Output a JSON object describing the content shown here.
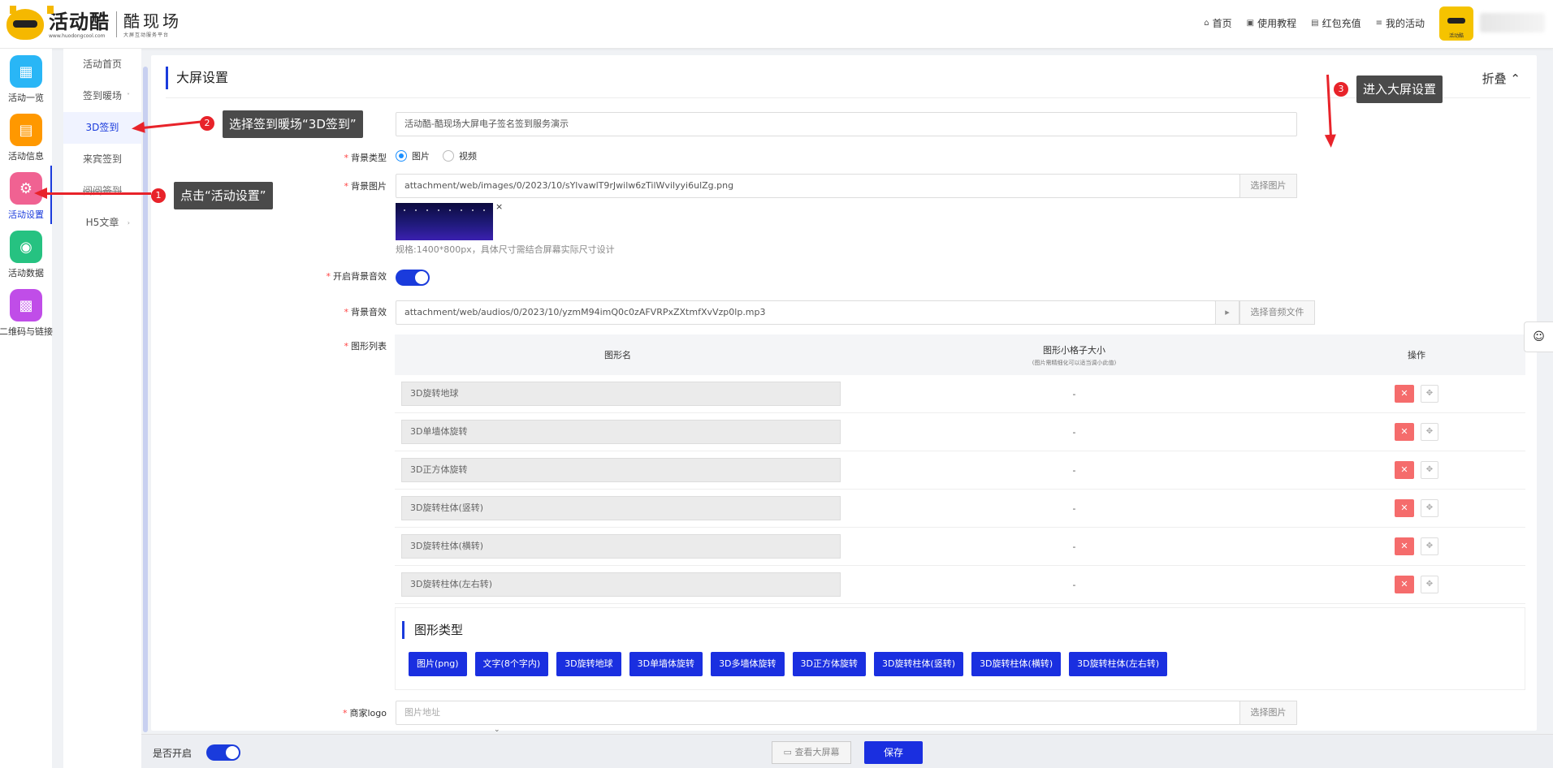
{
  "header": {
    "logo_main": "活动酷",
    "logo_url": "www.huodongcool.com",
    "logo_sub": "酷现场",
    "logo_sub_small": "大屏互动服务平台",
    "nav": [
      {
        "label": "首页",
        "icon": "home-icon",
        "glyph": "⌂"
      },
      {
        "label": "使用教程",
        "icon": "book-icon",
        "glyph": "▣"
      },
      {
        "label": "红包充值",
        "icon": "wallet-icon",
        "glyph": "▤"
      },
      {
        "label": "我的活动",
        "icon": "list-icon",
        "glyph": "≡"
      }
    ],
    "avatar_label": "活动酷"
  },
  "rail": [
    {
      "label": "活动一览",
      "icon": "grid-icon",
      "glyph": "▦",
      "color": "#29b6f6"
    },
    {
      "label": "活动信息",
      "icon": "document-icon",
      "glyph": "▤",
      "color": "#ff9800"
    },
    {
      "label": "活动设置",
      "icon": "gear-icon",
      "glyph": "⚙",
      "color": "#f06292"
    },
    {
      "label": "活动数据",
      "icon": "database-icon",
      "glyph": "◉",
      "color": "#26c281"
    },
    {
      "label": "二维码与链接",
      "icon": "qrcode-icon",
      "glyph": "▩",
      "color": "#c04de8"
    }
  ],
  "submenu": [
    {
      "label": "活动首页"
    },
    {
      "label": "签到暖场"
    },
    {
      "label": "3D签到"
    },
    {
      "label": "来宾签到"
    },
    {
      "label": "阅阅签到"
    },
    {
      "label": "H5文章"
    }
  ],
  "panel": {
    "title": "大屏设置",
    "collapse_label": "折叠",
    "collapse_glyph": "⌃",
    "title_input": "活动酷-酷现场大屏电子签名签到服务演示",
    "bg_type_label": "背景类型",
    "bg_type_options": [
      "图片",
      "视频"
    ],
    "bg_image_label": "背景图片",
    "bg_image_value": "attachment/web/images/0/2023/10/sYlvawlT9rJwilw6zTilWvilyyi6ulZg.png",
    "select_image_label": "选择图片",
    "thumb_close": "×",
    "spec_hint": "规格:1400*800px，具体尺寸需结合屏幕实际尺寸设计",
    "bg_sound_switch_label": "开启背景音效",
    "bg_sound_label": "背景音效",
    "bg_sound_value": "attachment/web/audios/0/2023/10/yzmM94imQ0c0zAFVRPxZXtmfXvVzp0lp.mp3",
    "play_glyph": "▸",
    "select_audio_label": "选择音频文件",
    "shape_list_label": "图形列表",
    "table": {
      "headers": [
        "图形名",
        "图形小格子大小",
        "操作"
      ],
      "size_sub": "(图片需精细化可以适当调小此值)",
      "del_glyph": "✕",
      "move_glyph": "✥",
      "rows": [
        {
          "name": "3D旋转地球",
          "size": "-"
        },
        {
          "name": "3D单墙体旋转",
          "size": "-"
        },
        {
          "name": "3D正方体旋转",
          "size": "-"
        },
        {
          "name": "3D旋转柱体(竖转)",
          "size": "-"
        },
        {
          "name": "3D旋转柱体(横转)",
          "size": "-"
        },
        {
          "name": "3D旋转柱体(左右转)",
          "size": "-"
        }
      ]
    },
    "shape_types_title": "图形类型",
    "shape_types": [
      "图片(png)",
      "文字(8个字内)",
      "3D旋转地球",
      "3D单墙体旋转",
      "3D多墙体旋转",
      "3D正方体旋转",
      "3D旋转柱体(竖转)",
      "3D旋转柱体(横转)",
      "3D旋转柱体(左右转)"
    ],
    "merchant_logo_label": "商家logo",
    "merchant_logo_placeholder": "图片地址",
    "merchant_logo_button": "选择图片"
  },
  "bottom_bar": {
    "enable_label": "是否开启",
    "view_button": "查看大屏幕",
    "view_glyph": "▭",
    "save_button": "保存",
    "scroll_caret": "⌄"
  },
  "float_glyph": "☺",
  "annotations": [
    {
      "number": "1",
      "text": "点击“活动设置”"
    },
    {
      "number": "2",
      "text": "选择签到暖场“3D签到”"
    },
    {
      "number": "3",
      "text": "进入大屏设置"
    }
  ]
}
